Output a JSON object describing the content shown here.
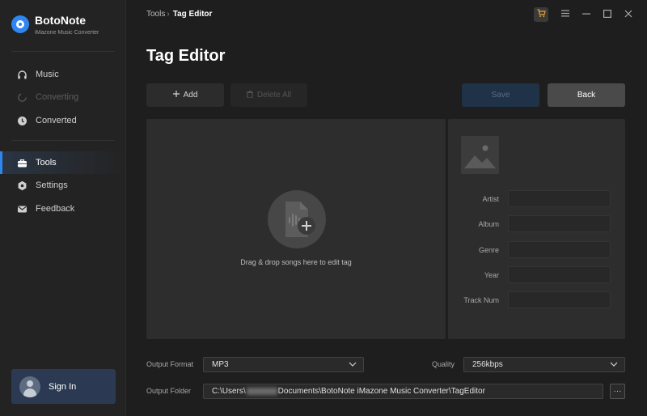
{
  "app": {
    "name": "BotoNote",
    "subtitle": "iMazone Music Converter"
  },
  "sidebar": {
    "items": [
      {
        "label": "Music",
        "icon": "headphones-icon",
        "state": "normal"
      },
      {
        "label": "Converting",
        "icon": "spinner-icon",
        "state": "disabled"
      },
      {
        "label": "Converted",
        "icon": "clock-icon",
        "state": "normal"
      },
      {
        "label": "Tools",
        "icon": "toolbox-icon",
        "state": "active"
      },
      {
        "label": "Settings",
        "icon": "gear-icon",
        "state": "normal"
      },
      {
        "label": "Feedback",
        "icon": "envelope-icon",
        "state": "normal"
      }
    ],
    "signin_label": "Sign In"
  },
  "breadcrumb": {
    "parent": "Tools",
    "separator": "›",
    "current": "Tag Editor"
  },
  "page": {
    "title": "Tag Editor"
  },
  "toolbar": {
    "add_label": "Add",
    "delete_all_label": "Delete All",
    "save_label": "Save",
    "back_label": "Back"
  },
  "dropzone": {
    "text": "Drag & drop songs here to edit tag"
  },
  "tags": {
    "fields": [
      {
        "label": "Artist",
        "value": ""
      },
      {
        "label": "Album",
        "value": ""
      },
      {
        "label": "Genre",
        "value": ""
      },
      {
        "label": "Year",
        "value": ""
      },
      {
        "label": "Track Num",
        "value": ""
      }
    ]
  },
  "output": {
    "format_label": "Output Format",
    "format_value": "MP3",
    "quality_label": "Quality",
    "quality_value": "256kbps",
    "folder_label": "Output Folder",
    "folder_prefix": "C:\\Users\\",
    "folder_suffix": "Documents\\BotoNote iMazone Music Converter\\TagEditor",
    "more_label": "···"
  },
  "colors": {
    "accent": "#2f86f0",
    "background": "#1e1e1e",
    "sidebar": "#232323",
    "panel": "#2d2d2d"
  }
}
